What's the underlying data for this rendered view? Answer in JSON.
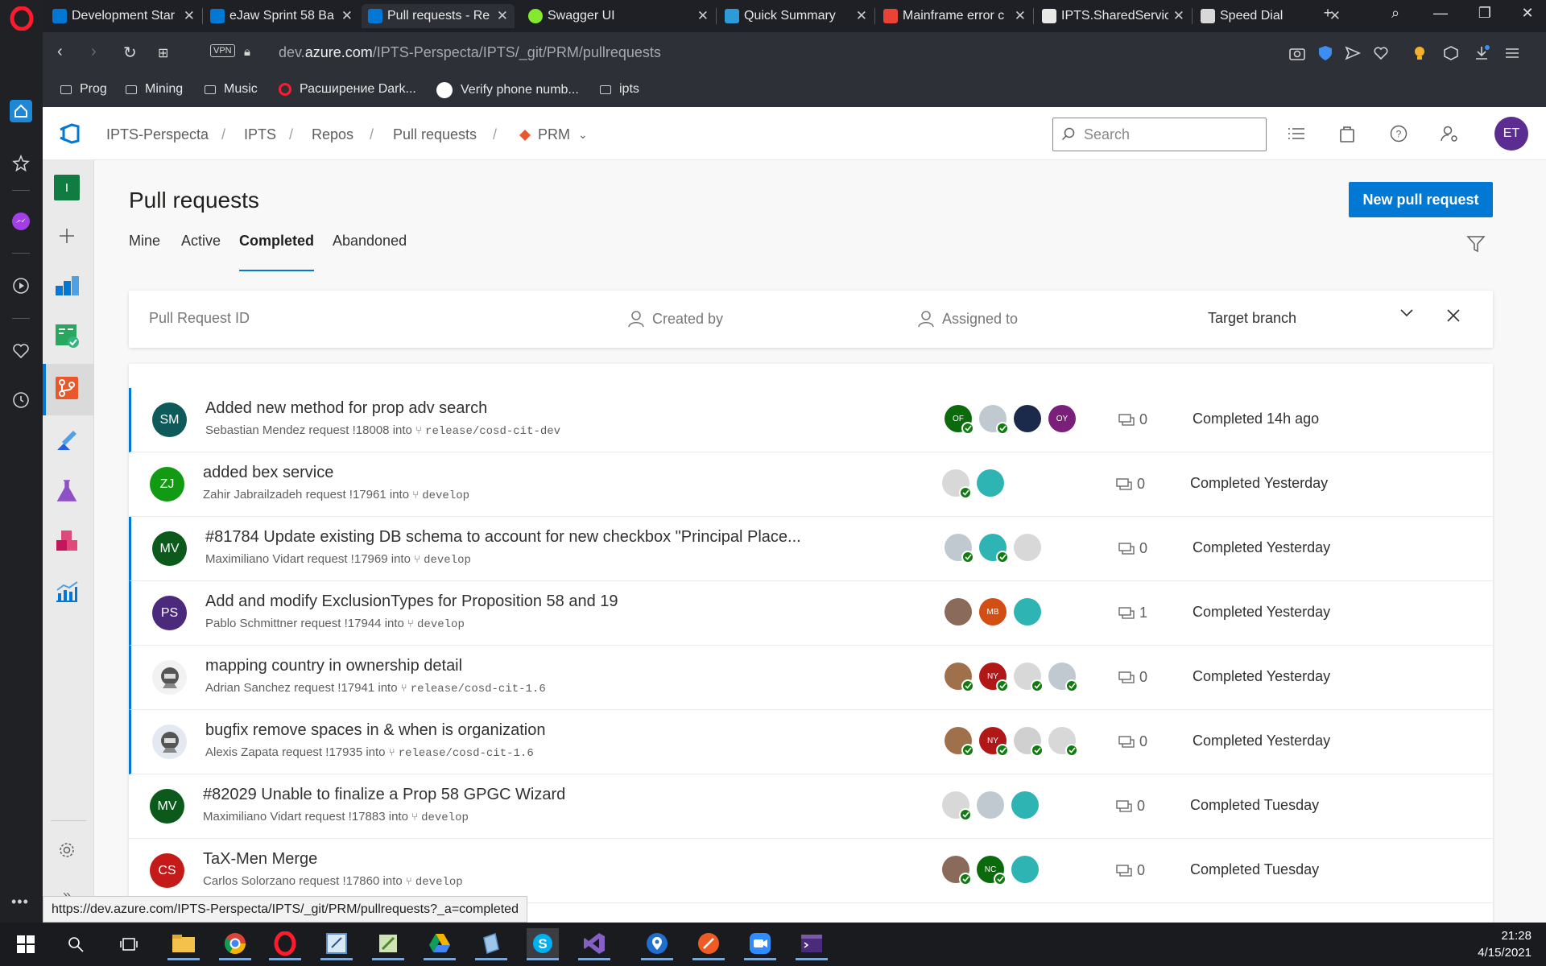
{
  "browser": {
    "tabs": [
      {
        "title": "Development Star",
        "active": false
      },
      {
        "title": "eJaw Sprint 58 Ba",
        "active": false
      },
      {
        "title": "Pull requests - Re",
        "active": true
      },
      {
        "title": "Swagger UI",
        "active": false
      },
      {
        "title": "Quick Summary",
        "active": false
      },
      {
        "title": "Mainframe error c",
        "active": false
      },
      {
        "title": "IPTS.SharedServic",
        "active": false
      },
      {
        "title": "Speed Dial",
        "active": false
      }
    ],
    "vpn_label": "VPN",
    "url_prefix": "dev.",
    "url_domain": "azure.com",
    "url_path": "/IPTS-Perspecta/IPTS/_git/PRM/pullrequests",
    "bookmarks": [
      "Prog",
      "Mining",
      "Music",
      "Расширение Dark...",
      "Verify phone numb...",
      "ipts"
    ],
    "status_url": "https://dev.azure.com/IPTS-Perspecta/IPTS/_git/PRM/pullrequests?_a=completed"
  },
  "ado": {
    "breadcrumb": [
      "IPTS-Perspecta",
      "IPTS",
      "Repos",
      "Pull requests",
      "PRM"
    ],
    "search_placeholder": "Search",
    "user_initials": "ET",
    "org_initial": "I",
    "page_title": "Pull requests",
    "new_pr_label": "New pull request",
    "tabs": [
      "Mine",
      "Active",
      "Completed",
      "Abandoned"
    ],
    "selected_tab": "Completed",
    "filters": {
      "pr_id_placeholder": "Pull Request ID",
      "created_by": "Created by",
      "assigned_to": "Assigned to",
      "target_branch": "Target branch"
    },
    "pull_requests": [
      {
        "initials": "SM",
        "color": "#0e5a5a",
        "title": "Added new method for prop adv search",
        "author": "Sebastian Mendez",
        "id": "!18008",
        "branch": "release/cosd-cit-dev",
        "comments": "0",
        "status": "Completed 14h ago",
        "marked": true,
        "reviewers": [
          {
            "label": "OF",
            "color": "#0b6a0b",
            "check": true
          },
          {
            "label": "",
            "color": "#c0c8d0",
            "check": true
          },
          {
            "label": "",
            "color": "#1b2a4a",
            "check": false
          },
          {
            "label": "OY",
            "color": "#7a1f7a",
            "check": false
          }
        ]
      },
      {
        "initials": "ZJ",
        "color": "#129b12",
        "title": "added bex service",
        "author": "Zahir Jabrailzadeh",
        "id": "!17961",
        "branch": "develop",
        "comments": "0",
        "status": "Completed Yesterday",
        "marked": false,
        "reviewers": [
          {
            "label": "",
            "color": "#d8d8d8",
            "check": true
          },
          {
            "label": "",
            "color": "#2fb4b4",
            "check": false
          }
        ]
      },
      {
        "initials": "MV",
        "color": "#0b5a1c",
        "title": "#81784 Update existing DB schema to account for new checkbox \"Principal Place...",
        "author": "Maximiliano Vidart",
        "id": "!17969",
        "branch": "develop",
        "comments": "0",
        "status": "Completed Yesterday",
        "marked": true,
        "reviewers": [
          {
            "label": "",
            "color": "#c0c8d0",
            "check": true
          },
          {
            "label": "",
            "color": "#2fb4b4",
            "check": true
          },
          {
            "label": "",
            "color": "#d8d8d8",
            "check": false
          }
        ]
      },
      {
        "initials": "PS",
        "color": "#4b2a7b",
        "title": "Add and modify ExclusionTypes for Proposition 58 and 19",
        "author": "Pablo Schmittner",
        "id": "!17944",
        "branch": "develop",
        "comments": "1",
        "status": "Completed Yesterday",
        "marked": true,
        "reviewers": [
          {
            "label": "",
            "color": "#8a6a5a",
            "check": false
          },
          {
            "label": "MB",
            "color": "#d24e12",
            "check": false
          },
          {
            "label": "",
            "color": "#2fb4b4",
            "check": false
          }
        ]
      },
      {
        "initials": "",
        "color": "#f2f2f2",
        "title": "mapping country in ownership detail",
        "author": "Adrian Sanchez",
        "id": "!17941",
        "branch": "release/cosd-cit-1.6",
        "comments": "0",
        "status": "Completed Yesterday",
        "marked": true,
        "reviewers": [
          {
            "label": "",
            "color": "#a0704a",
            "check": true
          },
          {
            "label": "NY",
            "color": "#b01818",
            "check": true
          },
          {
            "label": "",
            "color": "#d8d8d8",
            "check": true
          },
          {
            "label": "",
            "color": "#c0c8d0",
            "check": true
          }
        ]
      },
      {
        "initials": "",
        "color": "#e4e8f0",
        "title": "bugfix remove spaces in & when is organization",
        "author": "Alexis Zapata",
        "id": "!17935",
        "branch": "release/cosd-cit-1.6",
        "comments": "0",
        "status": "Completed Yesterday",
        "marked": true,
        "reviewers": [
          {
            "label": "",
            "color": "#a0704a",
            "check": true
          },
          {
            "label": "NY",
            "color": "#b01818",
            "check": true
          },
          {
            "label": "",
            "color": "#d0d0d0",
            "check": true
          },
          {
            "label": "",
            "color": "#d8d8d8",
            "check": true
          }
        ]
      },
      {
        "initials": "MV",
        "color": "#0b5a1c",
        "title": "#82029 Unable to finalize a Prop 58 GPGC Wizard",
        "author": "Maximiliano Vidart",
        "id": "!17883",
        "branch": "develop",
        "comments": "0",
        "status": "Completed Tuesday",
        "marked": false,
        "reviewers": [
          {
            "label": "",
            "color": "#d8d8d8",
            "check": true
          },
          {
            "label": "",
            "color": "#c0c8d0",
            "check": false
          },
          {
            "label": "",
            "color": "#2fb4b4",
            "check": false
          }
        ]
      },
      {
        "initials": "CS",
        "color": "#c41a1a",
        "title": "TaX-Men Merge",
        "author": "Carlos Solorzano",
        "id": "!17860",
        "branch": "develop",
        "comments": "0",
        "status": "Completed Tuesday",
        "marked": false,
        "reviewers": [
          {
            "label": "",
            "color": "#8a6a5a",
            "check": true
          },
          {
            "label": "NC",
            "color": "#0b6a0b",
            "check": true
          },
          {
            "label": "",
            "color": "#2fb4b4",
            "check": false
          }
        ]
      }
    ],
    "request_word": "request",
    "into_word": "into"
  },
  "taskbar": {
    "time": "21:28",
    "date": "4/15/2021"
  },
  "icons": {
    "accent": "#0078d4",
    "opera_red": "#ff1b2d"
  }
}
